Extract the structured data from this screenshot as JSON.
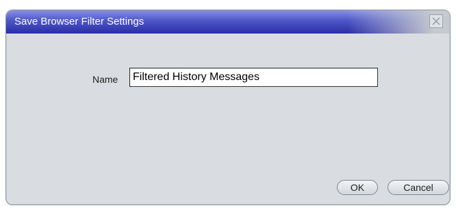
{
  "dialog": {
    "title": "Save Browser Filter Settings",
    "close_icon": "close-icon"
  },
  "form": {
    "name_label": "Name",
    "name_value": "Filtered History Messages"
  },
  "buttons": {
    "ok_label": "OK",
    "cancel_label": "Cancel"
  },
  "colors": {
    "titlebar_start": "#8a91e3",
    "titlebar_end": "#2a2ca4",
    "dialog_bg": "#d9dde1"
  }
}
